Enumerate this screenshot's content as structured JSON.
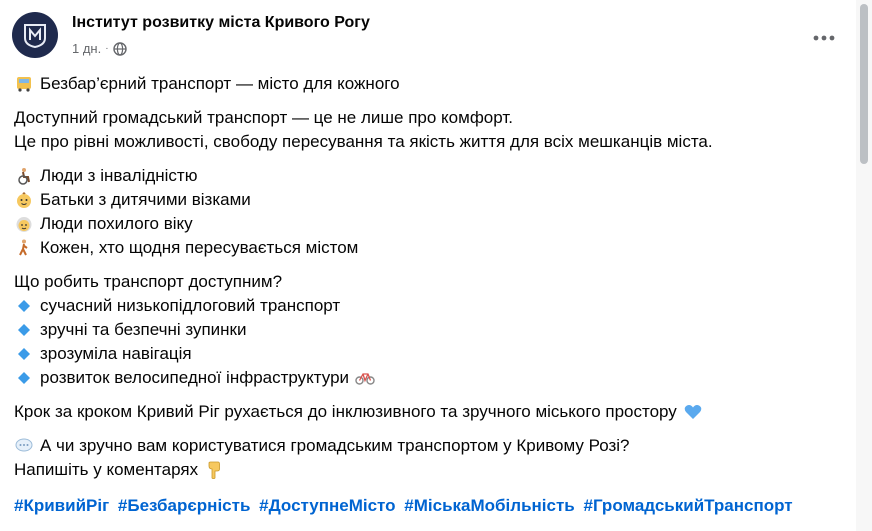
{
  "header": {
    "page_name": "Інститут розвитку міста Кривого Рогу",
    "time": "1 дн.",
    "separator": "·",
    "audience_icon": "globe-icon",
    "more_icon": "more-horizontal-icon"
  },
  "post": {
    "title": "Безбар’єрний транспорт — місто для кожного",
    "title_icon": "bus-icon",
    "intro_line1": "Доступний громадський транспорт — це не лише про комфорт.",
    "intro_line2": "Це про рівні можливості, свободу пересування та якість життя для всіх мешканців міста.",
    "audience": [
      {
        "icon": "wheelchair-person-icon",
        "text": "Люди з інвалідністю"
      },
      {
        "icon": "baby-icon",
        "text": "Батьки з дитячими візками"
      },
      {
        "icon": "older-person-icon",
        "text": "Люди похилого віку"
      },
      {
        "icon": "walking-person-icon",
        "text": "Кожен, хто щодня пересувається містом"
      }
    ],
    "question": "Що робить транспорт доступним?",
    "features": [
      {
        "icon": "blue-diamond-icon",
        "text": "сучасний низькопідлоговий транспорт"
      },
      {
        "icon": "blue-diamond-icon",
        "text": "зручні та безпечні зупинки"
      },
      {
        "icon": "blue-diamond-icon",
        "text": "зрозуміла навігація"
      },
      {
        "icon": "blue-diamond-icon",
        "text": "розвиток велосипедної інфраструктури"
      }
    ],
    "bike_icon": "bicycle-icon",
    "step_line": "Крок за кроком Кривий Ріг рухається до інклюзивного та зручного міського простору",
    "heart_icon": "blue-heart-icon",
    "ask_icon": "speech-bubble-icon",
    "ask_line1": "А чи зручно вам користуватися громадським транспортом у Кривому Розі?",
    "ask_line2": "Напишіть у коментарях",
    "point_icon": "point-down-icon",
    "hashtags": [
      "#КривийРіг",
      "#Безбарєрність",
      "#ДоступнеМісто",
      "#МіськаМобільність",
      "#ГромадськийТранспорт"
    ]
  },
  "colors": {
    "text": "#050505",
    "secondary": "#65676b",
    "link": "#0064d1",
    "avatar_bg": "#1f2a4d",
    "diamond": "#3b9be8"
  }
}
